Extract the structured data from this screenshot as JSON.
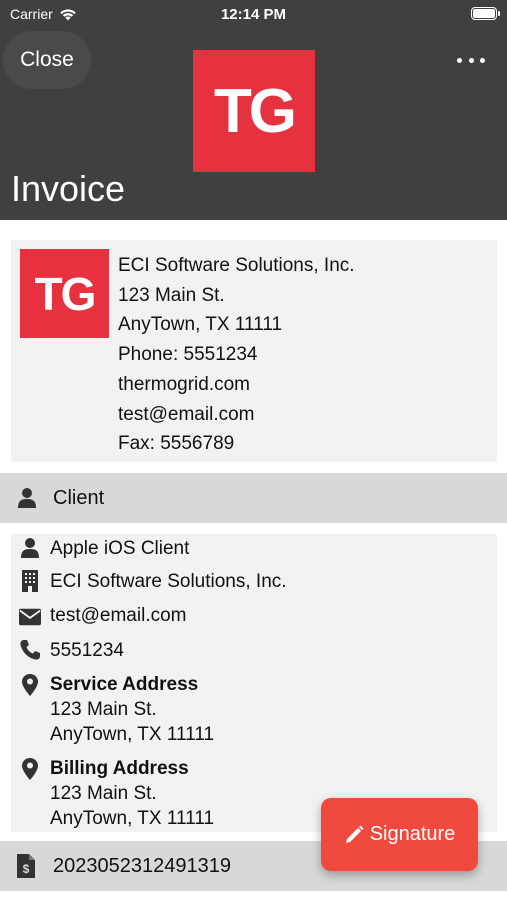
{
  "status_bar": {
    "carrier": "Carrier",
    "time": "12:14 PM"
  },
  "header": {
    "close_label": "Close",
    "logo_text": "TG",
    "title": "Invoice"
  },
  "company": {
    "logo_text": "TG",
    "lines": [
      "ECI Software Solutions, Inc.",
      "123 Main St.",
      "AnyTown, TX 11111",
      "Phone: 5551234",
      "thermogrid.com",
      "test@email.com",
      "Fax: 5556789"
    ]
  },
  "client_section": {
    "heading": "Client",
    "name": "Apple iOS Client",
    "company": "ECI Software Solutions, Inc.",
    "email": "test@email.com",
    "phone": "5551234",
    "service_address": {
      "label": "Service Address",
      "line1": "123 Main St.",
      "line2": "AnyTown, TX 11111"
    },
    "billing_address": {
      "label": "Billing Address",
      "line1": "123 Main St.",
      "line2": "AnyTown, TX 11111"
    }
  },
  "invoice": {
    "number": "2023052312491319"
  },
  "signature_button": {
    "label": "Signature"
  }
}
